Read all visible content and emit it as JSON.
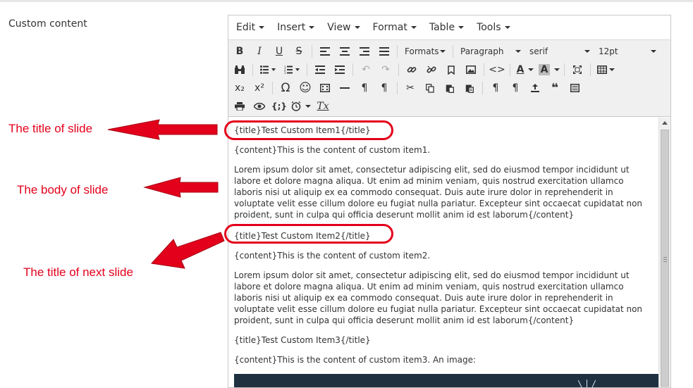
{
  "field_label": "Custom content",
  "menubar": {
    "items": [
      "Edit",
      "Insert",
      "View",
      "Format",
      "Table",
      "Tools"
    ]
  },
  "toolbar": {
    "formats_label": "Formats",
    "block_label": "Paragraph",
    "font_label": "serif",
    "size_label": "12pt",
    "bold": "B",
    "italic": "I",
    "underline": "U",
    "strike": "S",
    "subscript": "x₂",
    "superscript": "x²",
    "omega": "Ω",
    "emoji": "☺",
    "pilcrow": "¶",
    "quote": "❝",
    "source": "<>",
    "code": "{;}",
    "text_color": "A",
    "bg_color": "A",
    "clear_format": "Tx"
  },
  "content": {
    "title1": "{title}Test Custom Item1{/title}",
    "content1": "{content}This is the content of custom item1.",
    "lorem1": "Lorem ipsum dolor sit amet, consectetur adipiscing elit, sed do eiusmod tempor incididunt ut labore et dolore magna aliqua. Ut enim ad minim veniam, quis nostrud exercitation ullamco laboris nisi ut aliquip ex ea commodo consequat. Duis aute irure dolor in reprehenderit in voluptate velit esse cillum dolore eu fugiat nulla pariatur. Excepteur sint occaecat cupidatat non proident, sunt in culpa qui officia deserunt mollit anim id est laborum{/content}",
    "title2": "{title}Test Custom Item2{/title}",
    "content2": "{content}This is the content of custom item2.",
    "lorem2": "Lorem ipsum dolor sit amet, consectetur adipiscing elit, sed do eiusmod tempor incididunt ut labore et dolore magna aliqua. Ut enim ad minim veniam, quis nostrud exercitation ullamco laboris nisi ut aliquip ex ea commodo consequat. Duis aute irure dolor in reprehenderit in voluptate velit esse cillum dolore eu fugiat nulla pariatur. Excepteur sint occaecat cupidatat non proident, sunt in culpa qui officia deserunt mollit anim id est laborum{/content}",
    "title3": "{title}Test Custom Item3{/title}",
    "content3": "{content}This is the content of custom item3. An image:"
  },
  "annotations": {
    "title_of_slide": "The title of slide",
    "body_of_slide": "The body of slide",
    "title_of_next_slide": "The title of next slide"
  },
  "colors": {
    "annotation": "#e3001b",
    "toolbar_bg": "#f0f0f0",
    "image_bg": "#1f3140"
  }
}
